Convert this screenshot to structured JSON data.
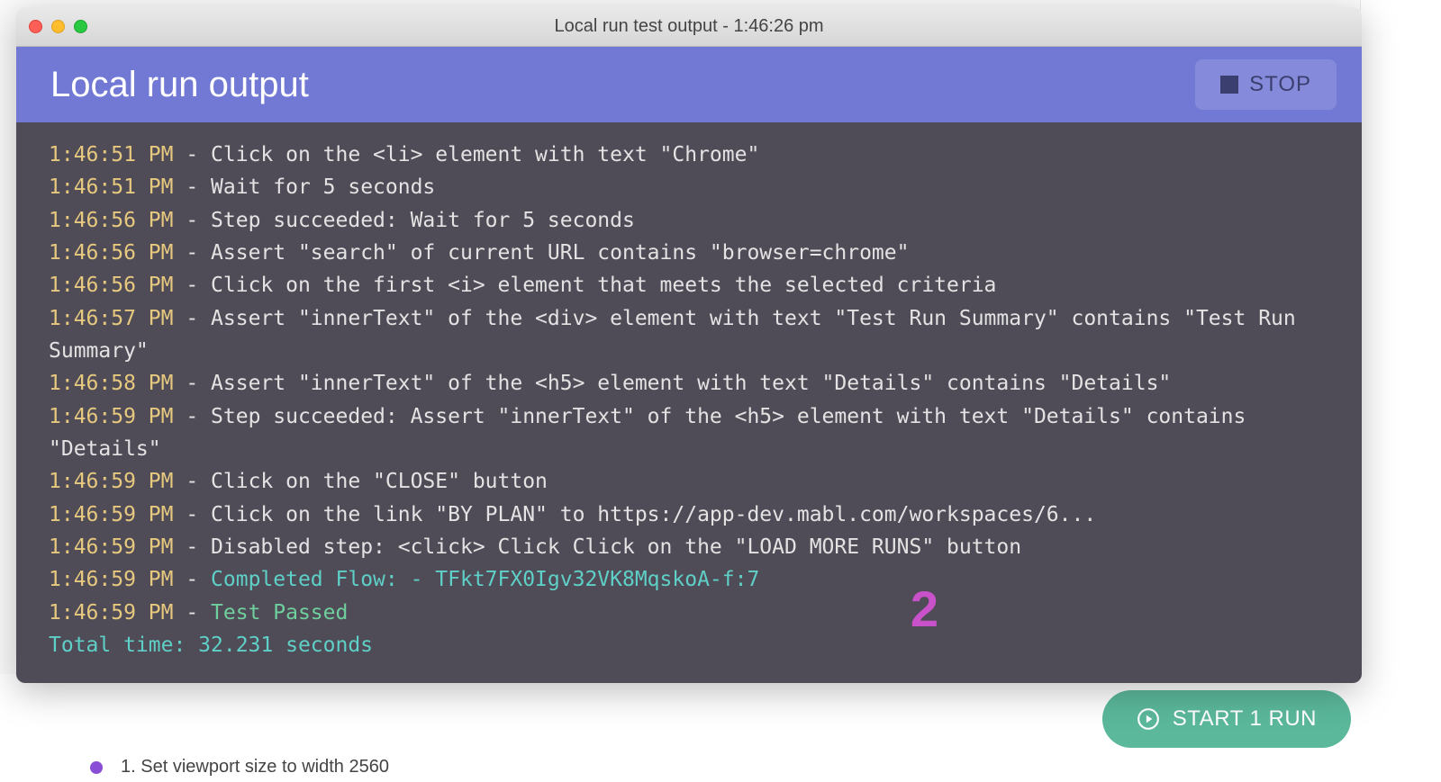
{
  "window": {
    "title": "Local run test output - 1:46:26 pm"
  },
  "header": {
    "title": "Local run output",
    "stop_label": "STOP"
  },
  "annotation": {
    "marker": "2"
  },
  "backdrop": {
    "step_text": "1. Set viewport size to width 2560",
    "start_run_label": "START 1 RUN"
  },
  "log": {
    "lines": [
      {
        "ts": "1:46:51 PM",
        "msg": "Click on the <li> element with text \"Chrome\"",
        "cls": "msg"
      },
      {
        "ts": "1:46:51 PM",
        "msg": "Wait for 5 seconds",
        "cls": "msg"
      },
      {
        "ts": "1:46:56 PM",
        "msg": "Step succeeded: Wait for 5 seconds",
        "cls": "msg"
      },
      {
        "ts": "1:46:56 PM",
        "msg": "Assert \"search\" of current URL contains \"browser=chrome\"",
        "cls": "msg"
      },
      {
        "ts": "1:46:56 PM",
        "msg": "Click on the first <i> element that meets the selected criteria",
        "cls": "msg"
      },
      {
        "ts": "1:46:57 PM",
        "msg": "Assert \"innerText\" of the <div> element with text \"Test Run Summary\" contains \"Test Run Summary\"",
        "cls": "msg"
      },
      {
        "ts": "1:46:58 PM",
        "msg": "Assert \"innerText\" of the <h5> element with text \"Details\" contains \"Details\"",
        "cls": "msg"
      },
      {
        "ts": "1:46:59 PM",
        "msg": "Step succeeded: Assert \"innerText\" of the <h5> element with text \"Details\" contains \"Details\"",
        "cls": "msg"
      },
      {
        "ts": "1:46:59 PM",
        "msg": "Click on the \"CLOSE\" button",
        "cls": "msg"
      },
      {
        "ts": "1:46:59 PM",
        "msg": "Click on the link \"BY PLAN\" to https://app-dev.mabl.com/workspaces/6...",
        "cls": "msg"
      },
      {
        "ts": "1:46:59 PM",
        "msg": "Disabled step: <click> Click Click on the \"LOAD MORE RUNS\" button",
        "cls": "msg"
      },
      {
        "ts": "1:46:59 PM",
        "msg": "Completed Flow: - TFkt7FX0Igv32VK8MqskoA-f:7",
        "cls": "cyan"
      },
      {
        "ts": "1:46:59 PM",
        "msg": "Test Passed",
        "cls": "green"
      }
    ],
    "total_time": "Total time: 32.231 seconds"
  }
}
